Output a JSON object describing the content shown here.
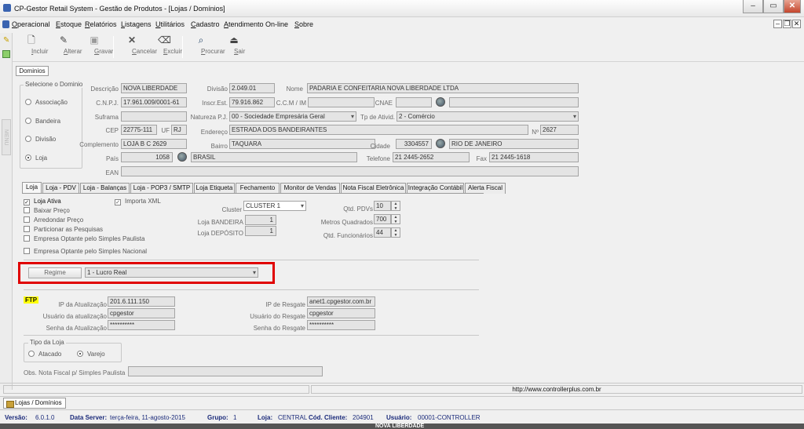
{
  "window": {
    "title": "CP-Gestor Retail System - Gestão de Produtos - [Lojas / Domínios]"
  },
  "menu": [
    "Operacional",
    "Estoque",
    "Relatórios",
    "Listagens",
    "Utilitários",
    "Cadastro",
    "Atendimento On-line",
    "Sobre"
  ],
  "toolbar": {
    "incluir": "Incluir",
    "alterar": "Alterar",
    "gravar": "Gravar",
    "cancelar": "Cancelar",
    "excluir": "Excluir",
    "procurar": "Procurar",
    "sair": "Sair"
  },
  "side_label": "MENU",
  "top_tab": "Dominios",
  "dominio": {
    "title": "Selecione o Dominio",
    "options": [
      "Associação",
      "Bandeira",
      "Divisão",
      "Loja"
    ],
    "selected": "Loja"
  },
  "form": {
    "descricao_label": "Descrição",
    "descricao": "NOVA LIBERDADE",
    "divisao_label": "Divisão",
    "divisao": "2.049.01",
    "nome_label": "Nome",
    "nome": "PADARIA E CONFEITARIA NOVA LIBERDADE LTDA",
    "cnpj_label": "C.N.P.J.",
    "cnpj": "17.961.009/0001-61",
    "inscr_label": "Inscr.Est.",
    "inscr": "79.916.862",
    "ccm_label": "C.C.M / IM",
    "ccm": "",
    "cnae_label": "CNAE",
    "cnae": "",
    "suframa_label": "Suframa",
    "suframa": "",
    "natureza_label": "Natureza P.J.",
    "natureza": "00 - Sociedade Empresária Geral",
    "tpativ_label": "Tp de Ativid.",
    "tpativ": "2 - Comércio",
    "cep_label": "CEP",
    "cep": "22775-111",
    "uf_label": "UF",
    "uf": "RJ",
    "endereco_label": "Endereço",
    "endereco": "ESTRADA DOS BANDEIRANTES",
    "numero_label": "Nº",
    "numero": "2627",
    "complemento_label": "Complemento",
    "complemento": "LOJA B C 2629",
    "bairro_label": "Bairro",
    "bairro": "TAQUARA",
    "cidade_label": "Cidade",
    "cidade_cod": "3304557",
    "cidade": "RIO DE JANEIRO",
    "pais_label": "País",
    "pais_cod": "1058",
    "pais": "BRASIL",
    "telefone_label": "Telefone",
    "telefone": "21 2445-2652",
    "fax_label": "Fax",
    "fax": "21 2445-1618",
    "ean_label": "EAN",
    "ean": ""
  },
  "tabs": [
    "Loja",
    "Loja - PDV",
    "Loja - Balanças",
    "Loja - POP3 / SMTP",
    "Loja Etiqueta",
    "Fechamento",
    "Monitor de Vendas",
    "Nota Fiscal Eletrônica",
    "Integração Contábil",
    "Alerta Fiscal"
  ],
  "loja": {
    "checks": [
      {
        "label": "Loja Ativa",
        "checked": true
      },
      {
        "label": "Baixar Preço",
        "checked": false
      },
      {
        "label": "Arredondar Preço",
        "checked": false
      },
      {
        "label": "Particionar as Pesquisas",
        "checked": false
      },
      {
        "label": "Empresa Optante pelo Simples Paulista",
        "checked": false
      }
    ],
    "simples_nacional": "Empresa Optante pelo Simples Nacional",
    "importa_xml": "Importa XML",
    "cluster_label": "Cluster",
    "cluster": "CLUSTER 1",
    "bandeira_label": "Loja BANDEIRA",
    "bandeira": "1",
    "deposito_label": "Loja DEPÓSITO",
    "deposito": "1",
    "pdvs_label": "Qtd. PDVs",
    "pdvs": "10",
    "metros_label": "Metros Quadrados",
    "metros": "700",
    "func_label": "Qtd. Funcionários",
    "func": "44",
    "regime_btn": "Regime",
    "regime": "1 - Lucro Real"
  },
  "ftp": {
    "title": "FTP",
    "ip_atual_label": "IP da Atualização",
    "ip_atual": "201.6.111.150",
    "usr_atual_label": "Usuário da atualização",
    "usr_atual": "cpgestor",
    "pwd_atual_label": "Senha da Atualização",
    "pwd_atual": "**********",
    "ip_resg_label": "IP de Resgate",
    "ip_resg": "anet1.cpgestor.com.br",
    "usr_resg_label": "Usuário do Resgate",
    "usr_resg": "cpgestor",
    "pwd_resg_label": "Senha do Resgate",
    "pwd_resg": "**********"
  },
  "tipo": {
    "title": "Tipo da Loja",
    "atacado": "Atacado",
    "varejo": "Varejo",
    "selected": "Varejo"
  },
  "obs_label": "Obs. Nota Fiscal p/ Simples Paulista",
  "status": {
    "url": "http://www.controllerplus.com.br"
  },
  "task_tab": "Lojas / Domínios",
  "info": {
    "versao_k": "Versão:",
    "versao": "6.0.1.0",
    "data_k": "Data Server:",
    "data": "terça-feira, 11-agosto-2015",
    "grupo_k": "Grupo:",
    "grupo": "1",
    "loja_k": "Loja:",
    "loja": "CENTRAL",
    "cod_k": "Cód. Cliente:",
    "cod": "204901",
    "usuario_k": "Usuário:",
    "usuario": "00001-CONTROLLER"
  },
  "footer_partial": "NOVA LIBERDADE"
}
